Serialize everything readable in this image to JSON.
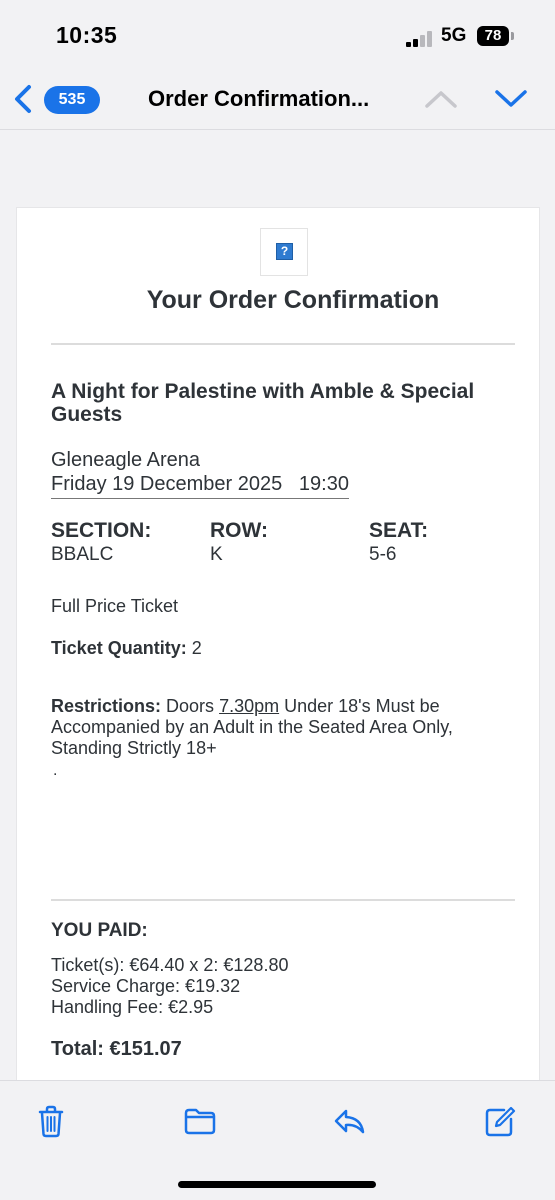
{
  "status_bar": {
    "time": "10:35",
    "network": "5G",
    "battery": "78"
  },
  "nav": {
    "unread_count": "535",
    "title": "Order Confirmation..."
  },
  "email": {
    "heading": "Your Order Confirmation",
    "event_title": "A Night for Palestine with Amble & Special Guests",
    "venue": "Gleneagle Arena",
    "datetime": "Friday 19 December 2025   19:30",
    "seating": [
      {
        "label": "SECTION:",
        "value": "BBALC"
      },
      {
        "label": "ROW:",
        "value": "K"
      },
      {
        "label": "SEAT:",
        "value": "5-6"
      }
    ],
    "ticket_type": "Full Price Ticket",
    "quantity": {
      "label": "Ticket Quantity:",
      "value": " 2"
    },
    "restrictions": {
      "label": "Restrictions:",
      "text_before": " Doors ",
      "time": "7.30pm",
      "text_after": " Under 18's Must be Accompanied by an Adult in the Seated Area Only, Standing Strictly 18+"
    },
    "dot": ".",
    "payment": {
      "heading": "YOU PAID:",
      "lines": [
        "Ticket(s): €64.40 x 2: €128.80",
        "Service Charge: €19.32",
        "Handling Fee: €2.95"
      ],
      "total": "Total: €151.07"
    }
  },
  "toolbar": [
    "trash-icon",
    "folder-icon",
    "reply-icon",
    "compose-icon"
  ],
  "colors": {
    "accent": "#1a73e8",
    "text": "#2e3338",
    "background": "#f2f2f4"
  }
}
